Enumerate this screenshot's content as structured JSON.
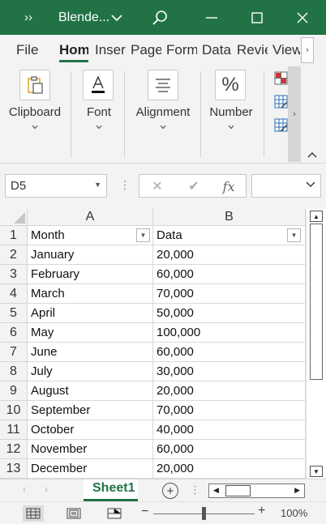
{
  "titlebar": {
    "more_glyph": "››",
    "doc_name": "Blende...",
    "caret": "⌄",
    "color": "#217346"
  },
  "tabs": [
    "File",
    "Hom",
    "Inser",
    "Page",
    "Form",
    "Data",
    "Revie",
    "View"
  ],
  "active_tab_index": 1,
  "ribbon": {
    "groups": [
      {
        "label": "Clipboard",
        "icon": "clipboard-icon"
      },
      {
        "label": "Font",
        "icon": "font-color-icon"
      },
      {
        "label": "Alignment",
        "icon": "align-icon"
      },
      {
        "label": "Number",
        "icon": "percent-icon",
        "glyph": "%"
      }
    ],
    "caret": "⌄"
  },
  "formula_bar": {
    "name_box": "D5",
    "fx": "fx",
    "cancel": "✕",
    "enter": "✔"
  },
  "columns": [
    "A",
    "B"
  ],
  "rows": [
    {
      "num": "1",
      "a": "Month",
      "b": "Data"
    },
    {
      "num": "2",
      "a": "January",
      "b": "20,000"
    },
    {
      "num": "3",
      "a": "February",
      "b": "60,000"
    },
    {
      "num": "4",
      "a": "March",
      "b": "70,000"
    },
    {
      "num": "5",
      "a": "April",
      "b": "50,000"
    },
    {
      "num": "6",
      "a": "May",
      "b": "100,000"
    },
    {
      "num": "7",
      "a": "June",
      "b": "60,000"
    },
    {
      "num": "8",
      "a": "July",
      "b": "30,000"
    },
    {
      "num": "9",
      "a": "August",
      "b": "20,000"
    },
    {
      "num": "10",
      "a": "September",
      "b": "70,000"
    },
    {
      "num": "11",
      "a": "October",
      "b": "40,000"
    },
    {
      "num": "12",
      "a": "November",
      "b": "60,000"
    },
    {
      "num": "13",
      "a": "December",
      "b": "20,000"
    }
  ],
  "sheets": [
    "Sheet1"
  ],
  "status": {
    "zoom": "100%",
    "zoom_fraction": 0.5,
    "minus": "−",
    "plus": "+",
    "add_sheet": "⊕"
  }
}
